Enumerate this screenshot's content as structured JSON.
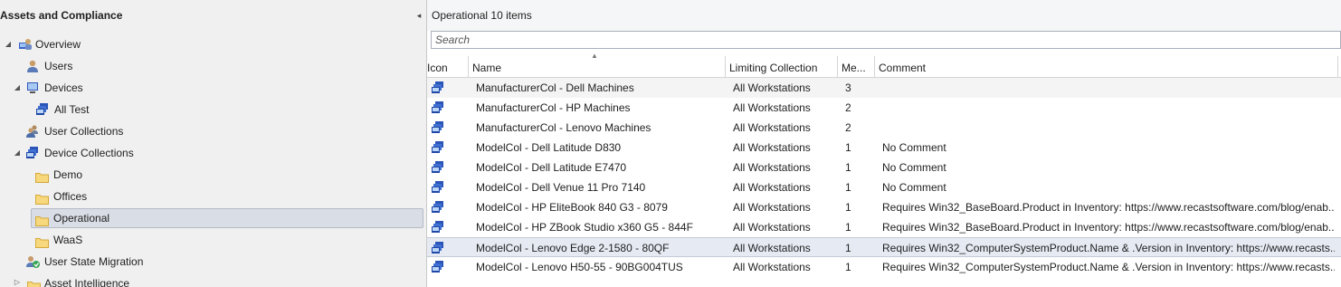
{
  "tree": {
    "title": "Assets and Compliance",
    "collapse_glyph": "◂",
    "items": [
      {
        "label": "Overview",
        "icon": "overview-icon"
      },
      {
        "label": "Users",
        "icon": "user-icon"
      },
      {
        "label": "Devices",
        "icon": "devices-icon"
      },
      {
        "label": "All Test",
        "icon": "device-collection-icon"
      },
      {
        "label": "User Collections",
        "icon": "user-collection-icon"
      },
      {
        "label": "Device Collections",
        "icon": "device-collection-icon"
      },
      {
        "label": "Demo",
        "icon": "folder-icon"
      },
      {
        "label": "Offices",
        "icon": "folder-icon"
      },
      {
        "label": "Operational",
        "icon": "folder-icon"
      },
      {
        "label": "WaaS",
        "icon": "folder-icon"
      },
      {
        "label": "User State Migration",
        "icon": "user-state-migration-icon"
      },
      {
        "label": "Asset Intelligence",
        "icon": "folder-icon"
      }
    ]
  },
  "list": {
    "title_name": "Operational",
    "title_count": "10 items",
    "search_placeholder": "Search",
    "columns": {
      "icon": "Icon",
      "name": "Name",
      "limiting": "Limiting Collection",
      "members": "Me...",
      "comment": "Comment"
    },
    "rows": [
      {
        "name": "ManufacturerCol - Dell Machines",
        "limiting": "All Workstations",
        "members": "3",
        "comment": ""
      },
      {
        "name": "ManufacturerCol - HP Machines",
        "limiting": "All Workstations",
        "members": "2",
        "comment": ""
      },
      {
        "name": "ManufacturerCol - Lenovo Machines",
        "limiting": "All Workstations",
        "members": "2",
        "comment": ""
      },
      {
        "name": "ModelCol - Dell Latitude D830",
        "limiting": "All Workstations",
        "members": "1",
        "comment": "No Comment"
      },
      {
        "name": "ModelCol - Dell Latitude E7470",
        "limiting": "All Workstations",
        "members": "1",
        "comment": "No Comment"
      },
      {
        "name": "ModelCol - Dell Venue 11 Pro 7140",
        "limiting": "All Workstations",
        "members": "1",
        "comment": "No Comment"
      },
      {
        "name": "ModelCol - HP EliteBook 840 G3 - 8079",
        "limiting": "All Workstations",
        "members": "1",
        "comment": "Requires Win32_BaseBoard.Product in Inventory: https://www.recastsoftware.com/blog/enab..."
      },
      {
        "name": "ModelCol - HP ZBook Studio x360 G5 - 844F",
        "limiting": "All Workstations",
        "members": "1",
        "comment": "Requires Win32_BaseBoard.Product in Inventory: https://www.recastsoftware.com/blog/enab..."
      },
      {
        "name": "ModelCol - Lenovo Edge 2-1580 - 80QF",
        "limiting": "All Workstations",
        "members": "1",
        "comment": "Requires Win32_ComputerSystemProduct.Name & .Version in Inventory: https://www.recasts..."
      },
      {
        "name": "ModelCol - Lenovo H50-55 - 90BG004TUS",
        "limiting": "All Workstations",
        "members": "1",
        "comment": "Requires Win32_ComputerSystemProduct.Name & .Version in Inventory: https://www.recasts..."
      }
    ]
  },
  "colors": {
    "folder": "#f2c94c",
    "collection_blue": "#2b55b8",
    "selection": "#d9dde5"
  }
}
